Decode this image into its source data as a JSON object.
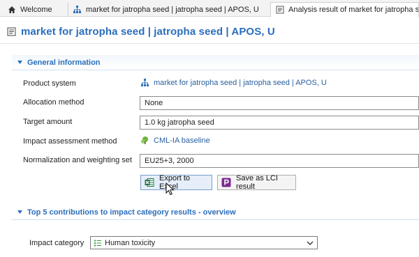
{
  "tabs": [
    {
      "label": "Welcome",
      "icon": "home-icon"
    },
    {
      "label": "market for jatropha seed | jatropha seed | APOS, U",
      "icon": "product-system-icon"
    },
    {
      "label": "Analysis result of market for jatropha se",
      "icon": "analysis-result-icon",
      "active": true
    }
  ],
  "editor": {
    "title": "market for jatropha seed | jatropha seed | APOS, U",
    "icon": "result-editor-icon"
  },
  "general": {
    "header": "General information",
    "product_system_label": "Product system",
    "product_system_value": "market for jatropha seed | jatropha seed | APOS, U",
    "allocation_label": "Allocation method",
    "allocation_value": "None",
    "target_label": "Target amount",
    "target_value": "1.0 kg jatropha seed",
    "impact_method_label": "Impact assessment method",
    "impact_method_value": "CML-IA baseline",
    "nw_label": "Normalization and weighting set",
    "nw_value": "EU25+3, 2000"
  },
  "buttons": {
    "export": "Export to Excel",
    "lci": "Save as LCI result"
  },
  "top5": {
    "header": "Top 5 contributions to impact category results - overview",
    "impact_category_label": "Impact category",
    "impact_category_value": "Human toxicity"
  },
  "colors": {
    "accent": "#2a6ebb",
    "link": "#2a5f9e",
    "excel_green": "#1e7145",
    "lci_purple": "#7b2c8f"
  }
}
